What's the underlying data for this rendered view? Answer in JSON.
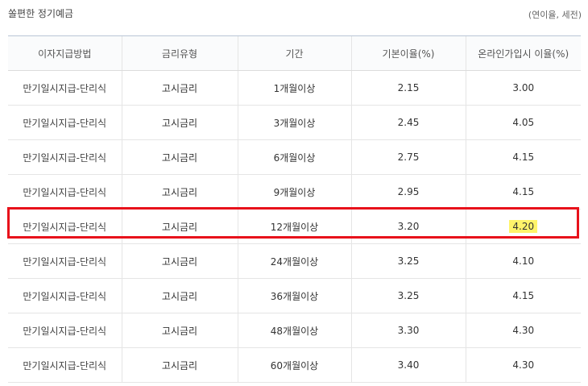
{
  "header": {
    "title": "쏠편한 정기예금",
    "unit_note": "(연이율, 세전)"
  },
  "table": {
    "columns": [
      "이자지급방법",
      "금리유형",
      "기간",
      "기본이율(%)",
      "온라인가입시 이율(%)"
    ],
    "rows": [
      {
        "method": "만기일시지급-단리식",
        "type": "고시금리",
        "period": "1개월이상",
        "base": "2.15",
        "online": "3.00"
      },
      {
        "method": "만기일시지급-단리식",
        "type": "고시금리",
        "period": "3개월이상",
        "base": "2.45",
        "online": "4.05"
      },
      {
        "method": "만기일시지급-단리식",
        "type": "고시금리",
        "period": "6개월이상",
        "base": "2.75",
        "online": "4.15"
      },
      {
        "method": "만기일시지급-단리식",
        "type": "고시금리",
        "period": "9개월이상",
        "base": "2.95",
        "online": "4.15"
      },
      {
        "method": "만기일시지급-단리식",
        "type": "고시금리",
        "period": "12개월이상",
        "base": "3.20",
        "online": "4.20"
      },
      {
        "method": "만기일시지급-단리식",
        "type": "고시금리",
        "period": "24개월이상",
        "base": "3.25",
        "online": "4.10"
      },
      {
        "method": "만기일시지급-단리식",
        "type": "고시금리",
        "period": "36개월이상",
        "base": "3.25",
        "online": "4.15"
      },
      {
        "method": "만기일시지급-단리식",
        "type": "고시금리",
        "period": "48개월이상",
        "base": "3.30",
        "online": "4.30"
      },
      {
        "method": "만기일시지급-단리식",
        "type": "고시금리",
        "period": "60개월이상",
        "base": "3.40",
        "online": "4.30"
      }
    ]
  },
  "highlight": {
    "row_index": 4,
    "box_color": "#e8121b",
    "marker_color": "#fff46a"
  }
}
